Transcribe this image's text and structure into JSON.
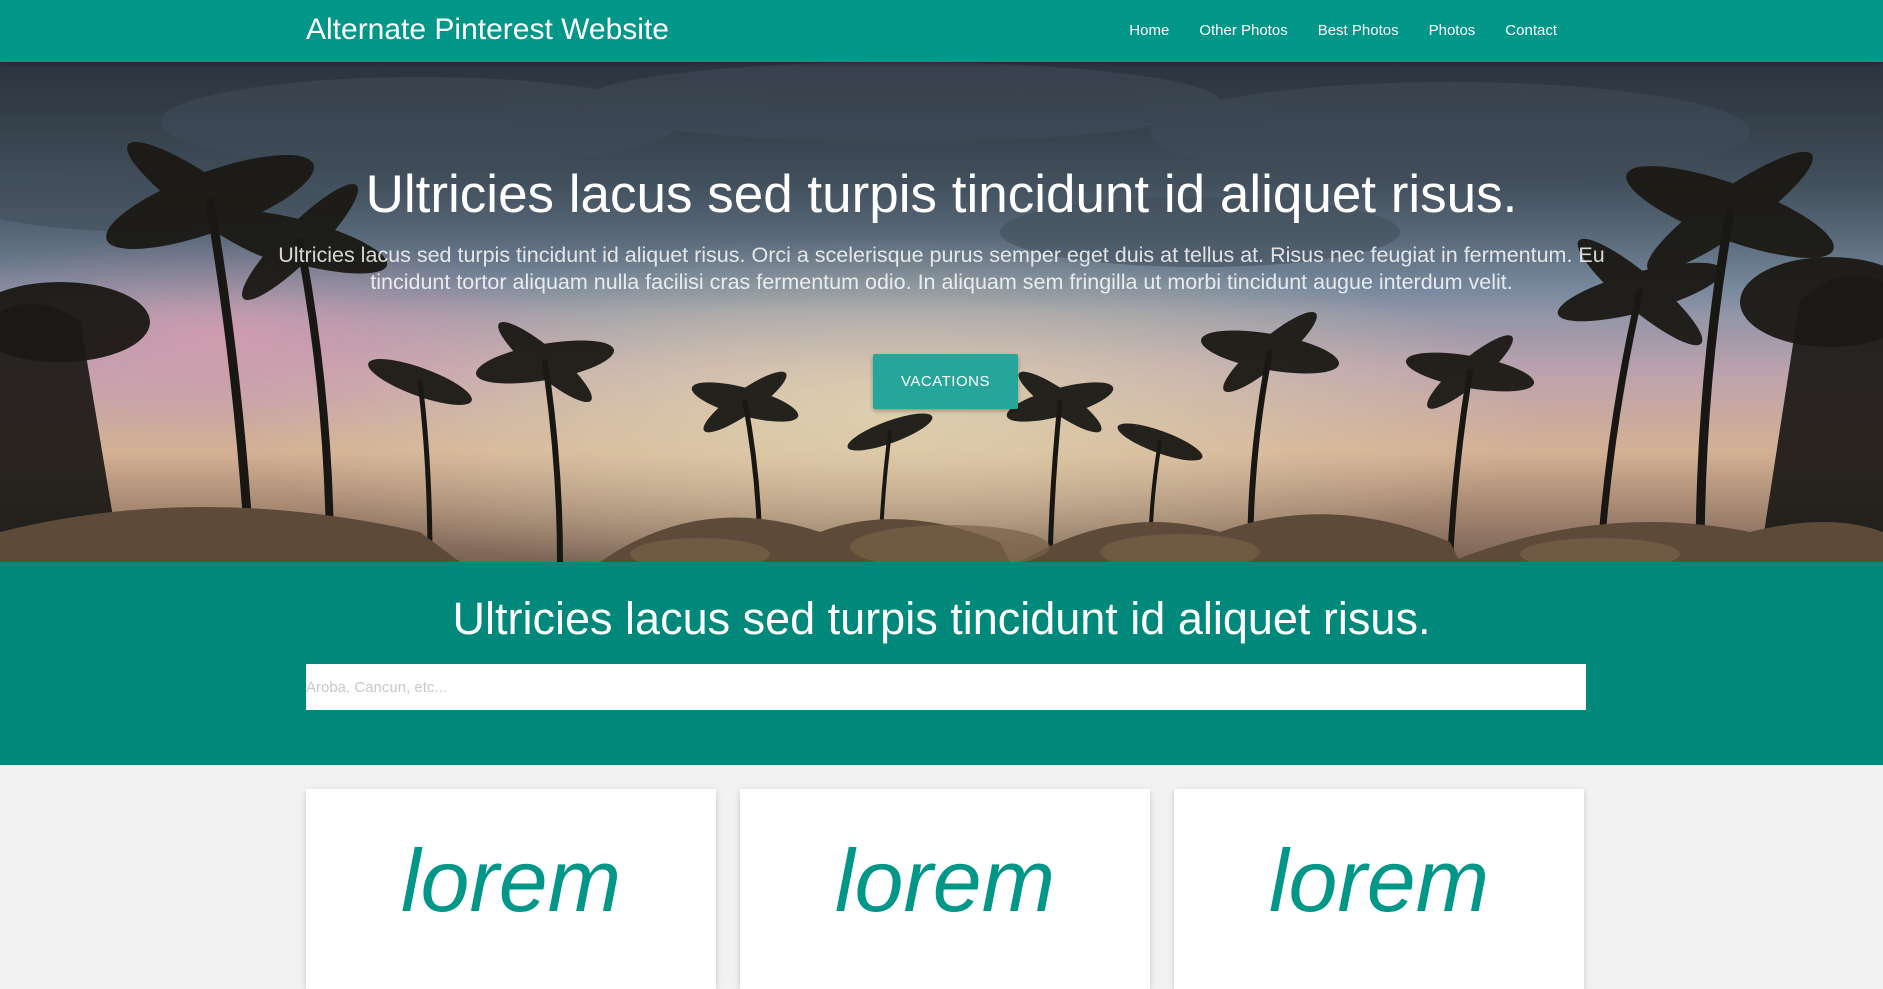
{
  "navbar": {
    "brand": "Alternate Pinterest Website",
    "links": [
      "Home",
      "Other Photos",
      "Best Photos",
      "Photos",
      "Contact"
    ]
  },
  "hero": {
    "title": "Ultricies lacus sed turpis tincidunt id aliquet risus.",
    "subtitle": "Ultricies lacus sed turpis tincidunt id aliquet risus. Orci a scelerisque purus semper eget duis at tellus at. Risus nec feugiat in fermentum. Eu tincidunt tortor aliquam nulla facilisi cras fermentum odio. In aliquam sem fringilla ut morbi tincidunt augue interdum velit.",
    "button_label": "VACATIONS"
  },
  "search": {
    "title": "Ultricies lacus sed turpis tincidunt id aliquet risus.",
    "placeholder": "Aroba, Cancun, etc..."
  },
  "cards": [
    {
      "word": "lorem"
    },
    {
      "word": "lorem"
    },
    {
      "word": "lorem"
    }
  ],
  "colors": {
    "primary": "#009688",
    "band": "#00897b",
    "button": "#26a69a",
    "page_bg": "#f2f2f2"
  }
}
